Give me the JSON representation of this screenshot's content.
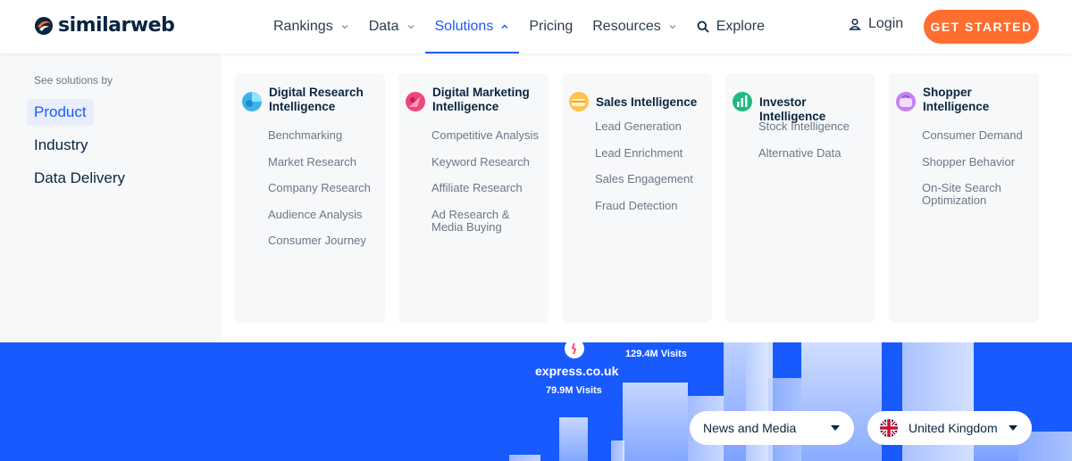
{
  "header": {
    "logo_text": "similarweb",
    "nav": [
      {
        "label": "Rankings",
        "has_chevron": true
      },
      {
        "label": "Data",
        "has_chevron": true
      },
      {
        "label": "Solutions",
        "has_chevron": true,
        "active": true
      },
      {
        "label": "Pricing",
        "has_chevron": false
      },
      {
        "label": "Resources",
        "has_chevron": true
      },
      {
        "label": "Explore",
        "icon": "search-icon"
      }
    ],
    "login_label": "Login",
    "cta_label": "GET STARTED"
  },
  "menu": {
    "see_by_label": "See solutions by",
    "side_items": [
      {
        "label": "Product",
        "active": true
      },
      {
        "label": "Industry"
      },
      {
        "label": "Data Delivery"
      }
    ],
    "cards": [
      {
        "title": "Digital Research Intelligence",
        "icon": "digital-research-icon",
        "links": [
          "Benchmarking",
          "Market Research",
          "Company Research",
          "Audience Analysis",
          "Consumer Journey"
        ]
      },
      {
        "title": "Digital Marketing Intelligence",
        "icon": "digital-marketing-icon",
        "links": [
          "Competitive Analysis",
          "Keyword Research",
          "Affiliate Research",
          "Ad Research & Media Buying"
        ]
      },
      {
        "title": "Sales Intelligence",
        "icon": "sales-intelligence-icon",
        "links": [
          "Lead Generation",
          "Lead Enrichment",
          "Sales Engagement",
          "Fraud Detection"
        ]
      },
      {
        "title": "Investor Intelligence",
        "icon": "investor-intelligence-icon",
        "links": [
          "Stock Intelligence",
          "Alternative Data"
        ]
      },
      {
        "title": "Shopper Intelligence",
        "icon": "shopper-intelligence-icon",
        "links": [
          "Consumer Demand",
          "Shopper Behavior",
          "On-Site Search Optimization"
        ]
      }
    ]
  },
  "hero": {
    "site_a_visits": "129.4M Visits",
    "site_b_name": "express.co.uk",
    "site_b_visits": "79.9M Visits",
    "industry_select": "News and Media",
    "country_select": "United Kingdom",
    "colors": {
      "background": "#195afe",
      "cta": "#ff6d2f"
    }
  }
}
